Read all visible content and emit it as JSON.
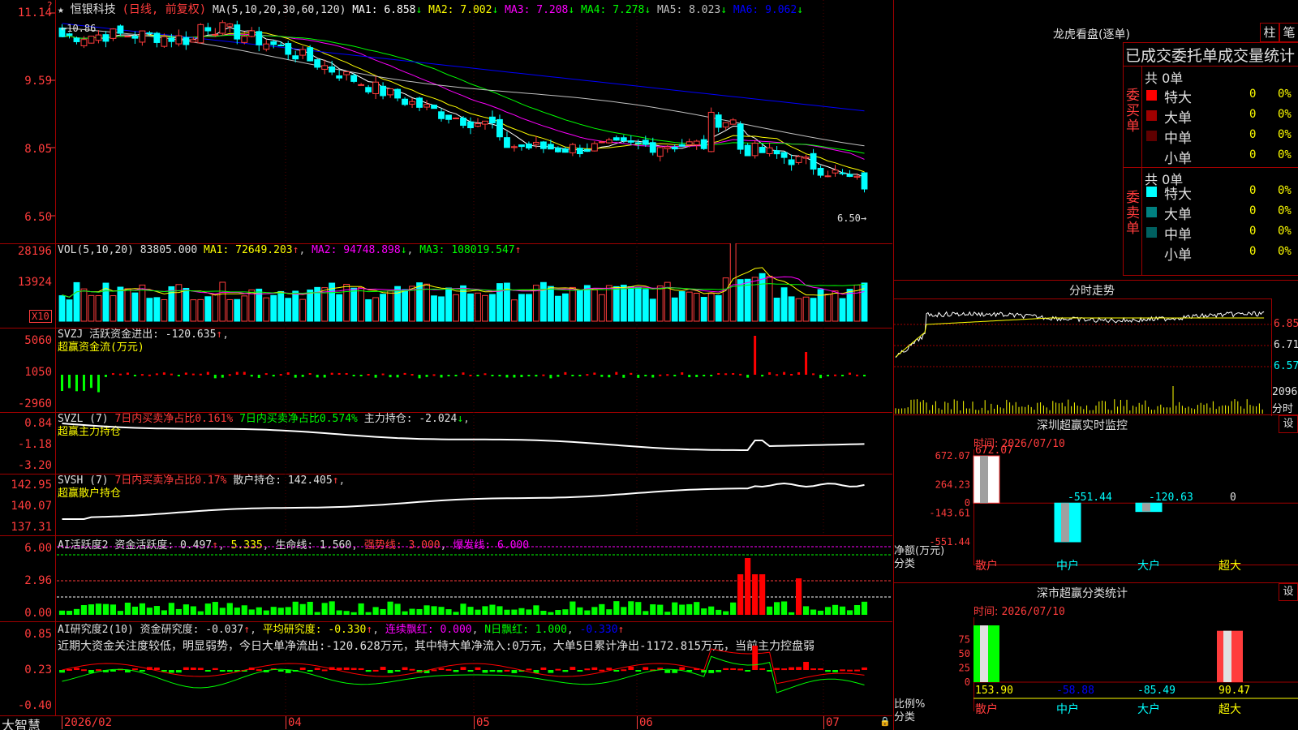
{
  "stock": {
    "star": "★",
    "name": "恒银科技",
    "mode": "(日线, 前复权)",
    "ma_label": "MA(5,10,20,30,60,120)",
    "ma": [
      {
        "label": "MA1:",
        "value": "6.858",
        "arrow": "↓",
        "color": "#ffffff"
      },
      {
        "label": "MA2:",
        "value": "7.002",
        "arrow": "↓",
        "color": "#ffff00"
      },
      {
        "label": "MA3:",
        "value": "7.208",
        "arrow": "↓",
        "color": "#ff00ff"
      },
      {
        "label": "MA4:",
        "value": "7.278",
        "arrow": "↓",
        "color": "#00ff00"
      },
      {
        "label": "MA5:",
        "value": "8.023",
        "arrow": "↓",
        "color": "#c0c0c0"
      },
      {
        "label": "MA6:",
        "value": "9.062",
        "arrow": "↓",
        "color": "#0000ff"
      }
    ],
    "high_mark": "10.86",
    "low_mark": "6.50",
    "corner_mark": "?"
  },
  "price_axis": {
    "labels": [
      "11.14",
      "9.59",
      "8.05",
      "6.50"
    ]
  },
  "vol": {
    "header": "VOL(5,10,20)",
    "value": "83805.000",
    "ma1_label": "MA1:",
    "ma1": "72649.203",
    "ma1_arrow": "↑",
    "ma2_label": "MA2:",
    "ma2": "94748.898",
    "ma2_arrow": "↓",
    "ma3_label": "MA3:",
    "ma3": "108019.547",
    "ma3_arrow": "↑",
    "axis": [
      "28196",
      "13924"
    ],
    "unit": "X10"
  },
  "svzj": {
    "name": "SVZJ",
    "label": "活跃资金进出:",
    "value": "-120.635",
    "arrow": "↑",
    "line2": "超赢资金流(万元)",
    "axis": [
      "5060",
      "1050",
      "-2960"
    ]
  },
  "svzl": {
    "name": "SVZL (7)",
    "red": "7日内买卖净占比0.161%",
    "green": "7日内买卖净占比0.574%",
    "label": "主力持仓:",
    "value": "-2.024",
    "arrow": "↓",
    "line2": "超赢主力持仓",
    "axis": [
      "0.84",
      "-1.18",
      "-3.20"
    ]
  },
  "svsh": {
    "name": "SVSH (7)",
    "red": "7日内买卖净占比0.17%",
    "label": "散户持仓:",
    "value": "142.405",
    "arrow": "↑",
    "line2": "超赢散户持仓",
    "axis": [
      "142.95",
      "140.07",
      "137.31"
    ]
  },
  "ai1": {
    "name": "AI活跃度2",
    "label": "资金活跃度:",
    "value": "0.497",
    "arrow": "↑",
    "v2": "5.335",
    "life_label": "生命线:",
    "life": "1.560",
    "strong_label": "强势线:",
    "strong": "3.000",
    "burst_label": "爆发线:",
    "burst": "6.000",
    "axis": [
      "6.00",
      "2.96",
      "0.00"
    ]
  },
  "ai2": {
    "name": "AI研究度2(10)",
    "label": "资金研究度:",
    "value": "-0.037",
    "arrow": "↑",
    "avg_label": "平均研究度:",
    "avg": "-0.330",
    "avg_arrow": "↑",
    "red_label": "连续飘红:",
    "red": "0.000",
    "n_label": "N日飘红:",
    "n": "1.000",
    "last": "-0.330",
    "last_arrow": "↑",
    "comment": "近期大资金关注度较低，明显弱势，今日大单净流出:-120.628万元，其中特大单净流入:0万元，大单5日累计净出-1172.815万元，当前主力控盘弱",
    "axis": [
      "0.85",
      "0.23",
      "-0.40"
    ]
  },
  "date_axis": {
    "brand": "大智慧",
    "dates": [
      "2026/02",
      "04",
      "05",
      "06",
      "07"
    ]
  },
  "right": {
    "lhb_title": "龙虎看盘(逐单)",
    "btn_zhu": "柱",
    "btn_bi": "笔",
    "stat_title": "已成交委托单成交量统计",
    "buy_side": "委买单",
    "sell_side": "委卖单",
    "buy_total": "共 0单",
    "sell_total": "共 0单",
    "buy_rows": [
      {
        "label": "特大",
        "val": "0",
        "pct": "0%",
        "color": "#ff0000"
      },
      {
        "label": "大单",
        "val": "0",
        "pct": "0%",
        "color": "#a00000"
      },
      {
        "label": "中单",
        "val": "0",
        "pct": "0%",
        "color": "#600000"
      },
      {
        "label": "小单",
        "val": "0",
        "pct": "0%",
        "color": "#000000"
      }
    ],
    "sell_rows": [
      {
        "label": "特大",
        "val": "0",
        "pct": "0%",
        "color": "#00ffff"
      },
      {
        "label": "大单",
        "val": "0",
        "pct": "0%",
        "color": "#008080"
      },
      {
        "label": "中单",
        "val": "0",
        "pct": "0%",
        "color": "#006060"
      },
      {
        "label": "小单",
        "val": "0",
        "pct": "0%",
        "color": "#000000"
      }
    ],
    "fs_title": "分时走势",
    "fs_axis": [
      "6.85",
      "6.71",
      "6.57"
    ],
    "fs_vol": "2096",
    "fs_vol_unit": "分时",
    "sz_title": "深圳超赢实时监控",
    "set": "设",
    "time_label": "时间:",
    "time": "2026/07/10",
    "sz_axis": [
      "672.07",
      "264.23",
      "0",
      "-143.61",
      "-551.44"
    ],
    "sz_unit1": "净额(万元)",
    "sz_unit2": "分类",
    "sz_values": [
      "672.07",
      "-551.44",
      "-120.63",
      "0"
    ],
    "cats": [
      "散户",
      "中户",
      "大户",
      "超大"
    ],
    "cls_title": "深市超赢分类统计",
    "cls_axis": [
      "75",
      "50",
      "25",
      "0"
    ],
    "cls_unit1": "比例%",
    "cls_unit2": "分类",
    "cls_values": [
      "153.90",
      "-58.88",
      "-85.49",
      "90.47"
    ]
  },
  "colors": {
    "up": "#ff3c3c",
    "down": "#00ffff",
    "green": "#00ff00",
    "axis": "#a00000"
  }
}
